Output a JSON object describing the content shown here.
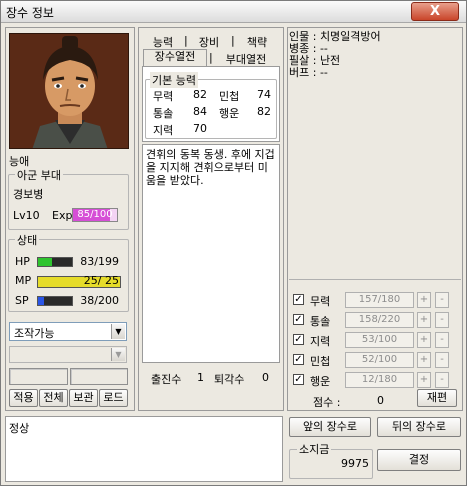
{
  "window": {
    "title": "장수 정보",
    "close_label": "X"
  },
  "general": {
    "name": "능애",
    "unit_group_title": "아군 부대",
    "unit_type": "경보병",
    "level": "Lv10",
    "exp_label": "Exp",
    "exp_value": "85/100",
    "exp_fraction": 0.85
  },
  "status": {
    "title": "상태",
    "bars": [
      {
        "label": "HP",
        "value": "83/199",
        "fraction": 0.42,
        "color": "#2fc42f"
      },
      {
        "label": "MP",
        "value": "25/ 25",
        "fraction": 1.0,
        "color": "#e6dc2a"
      },
      {
        "label": "SP",
        "value": "38/200",
        "fraction": 0.19,
        "color": "#2a55e6"
      }
    ]
  },
  "controls": {
    "mode_select": "조작가능",
    "second_select": "",
    "buttons": [
      "적용",
      "전체",
      "보관",
      "로드"
    ]
  },
  "tabs": {
    "row1": [
      "능력",
      "장비",
      "책략"
    ],
    "row2": [
      "장수열전",
      "부대열전"
    ],
    "active": "장수열전"
  },
  "abilities": {
    "title": "기본 능력",
    "rows": [
      {
        "a_label": "무력",
        "a_value": "82",
        "b_label": "민첩",
        "b_value": "74"
      },
      {
        "a_label": "통솔",
        "a_value": "84",
        "b_label": "행운",
        "b_value": "82"
      },
      {
        "a_label": "지력",
        "a_value": "70",
        "b_label": "",
        "b_value": ""
      }
    ]
  },
  "biography": "견휘의 동복 동생. 후에 지겁을 지지해 견휘으로부터 미움을 받았다.",
  "battle": {
    "sorties_label": "출진수",
    "sorties": "1",
    "retreats_label": "퇴각수",
    "retreats": "0"
  },
  "info_lines": [
    "인물 : 치명일격방어",
    "병종 : --",
    "필살 : 난전",
    "버프 : --"
  ],
  "stat_adjust": {
    "rows": [
      {
        "label": "무력",
        "value": "157/180"
      },
      {
        "label": "통솔",
        "value": "158/220"
      },
      {
        "label": "지력",
        "value": "53/100"
      },
      {
        "label": "민첩",
        "value": "52/100"
      },
      {
        "label": "행운",
        "value": "12/180"
      }
    ],
    "plus": "+",
    "minus": "-",
    "score_label": "점수 :",
    "score_value": "0",
    "reset_label": "재편"
  },
  "footer": {
    "status_text": "정상",
    "prev_label": "앞의 장수로",
    "next_label": "뒤의 장수로",
    "money_title": "소지금",
    "money_value": "9975",
    "confirm_label": "결정"
  }
}
